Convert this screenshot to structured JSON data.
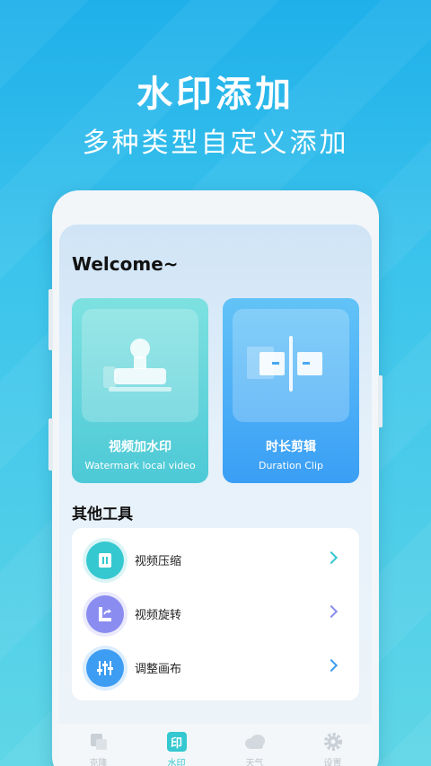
{
  "promo": {
    "title": "水印添加",
    "subtitle": "多种类型自定义添加"
  },
  "app": {
    "welcome": "Welcome~",
    "cards": [
      {
        "title": "视频加水印",
        "subtitle": "Watermark local video",
        "icon": "stamp-icon"
      },
      {
        "title": "时长剪辑",
        "subtitle": "Duration Clip",
        "icon": "clip-icon"
      }
    ],
    "other_tools_title": "其他工具",
    "tools": [
      {
        "label": "视频压缩",
        "icon": "compress-icon",
        "color": "#35c8d0"
      },
      {
        "label": "视频旋转",
        "icon": "rotate-icon",
        "color": "#8a8cf0"
      },
      {
        "label": "调整画布",
        "icon": "sliders-icon",
        "color": "#3d9df3"
      }
    ],
    "nav": [
      {
        "label": "克隆",
        "icon": "clone-icon",
        "active": false
      },
      {
        "label": "水印",
        "icon": "watermark-icon",
        "active": true
      },
      {
        "label": "天气",
        "icon": "cloud-icon",
        "active": false
      },
      {
        "label": "设置",
        "icon": "gear-icon",
        "active": false
      }
    ],
    "nav_badge_text": "印"
  },
  "colors": {
    "accent": "#3d9df3",
    "teal": "#35c8d0",
    "purple": "#8a8cf0",
    "nav_inactive": "#b9c1c8"
  }
}
